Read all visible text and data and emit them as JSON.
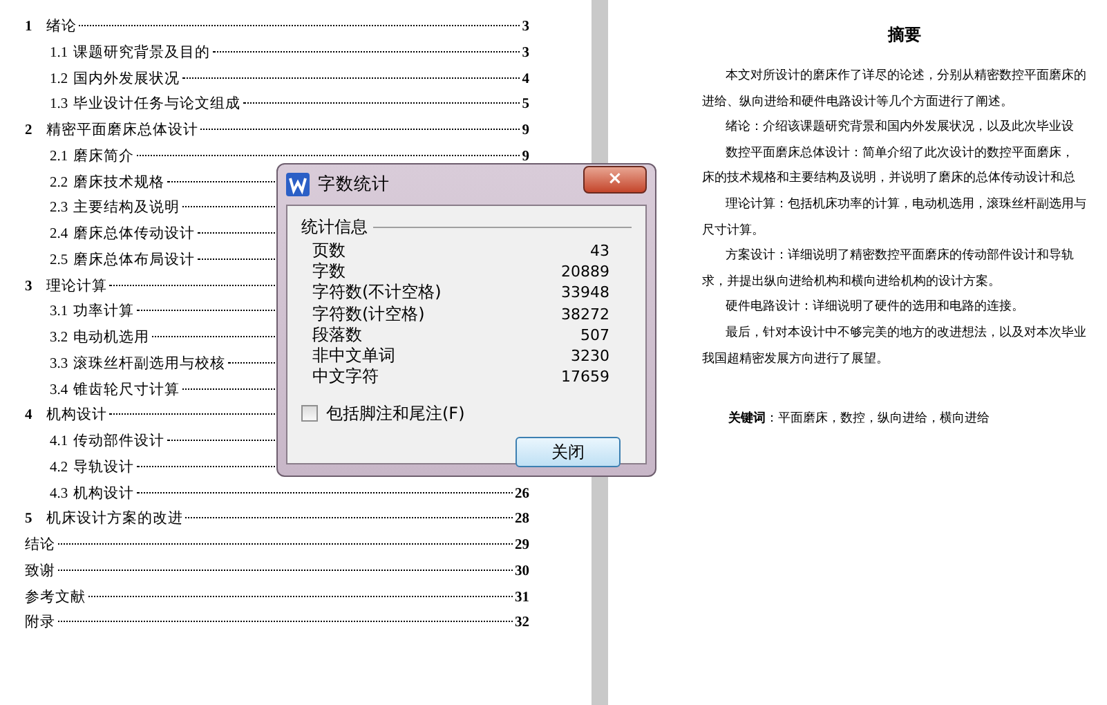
{
  "toc": [
    {
      "num": "1",
      "title": "绪论",
      "page": "3",
      "children": [
        {
          "num": "1.1",
          "title": "课题研究背景及目的",
          "page": "3"
        },
        {
          "num": "1.2",
          "title": "国内外发展状况",
          "page": "4"
        },
        {
          "num": "1.3",
          "title": "毕业设计任务与论文组成",
          "page": "5"
        }
      ]
    },
    {
      "num": "2",
      "title": "精密平面磨床总体设计",
      "page": "9",
      "children": [
        {
          "num": "2.1",
          "title": "磨床简介",
          "page": "9"
        },
        {
          "num": "2.2",
          "title": "磨床技术规格"
        },
        {
          "num": "2.3",
          "title": "主要结构及说明"
        },
        {
          "num": "2.4",
          "title": "磨床总体传动设计"
        },
        {
          "num": "2.5",
          "title": "磨床总体布局设计"
        }
      ]
    },
    {
      "num": "3",
      "title": "理论计算",
      "children": [
        {
          "num": "3.1",
          "title": "功率计算"
        },
        {
          "num": "3.2",
          "title": "电动机选用"
        },
        {
          "num": "3.3",
          "title": "滚珠丝杆副选用与校核"
        },
        {
          "num": "3.4",
          "title": "锥齿轮尺寸计算"
        }
      ]
    },
    {
      "num": "4",
      "title": "机构设计",
      "children": [
        {
          "num": "4.1",
          "title": "传动部件设计"
        },
        {
          "num": "4.2",
          "title": "导轨设计"
        },
        {
          "num": "4.3",
          "title": "机构设计",
          "page": "26"
        }
      ]
    },
    {
      "num": "5",
      "title": "机床设计方案的改进",
      "page": "28"
    },
    {
      "title": "结论",
      "page": "29"
    },
    {
      "title": "致谢",
      "page": "30"
    },
    {
      "title": "参考文献",
      "page": "31"
    },
    {
      "title": "附录",
      "page": "32"
    }
  ],
  "abstract": {
    "title": "摘要",
    "lines": [
      {
        "text": "本文对所设计的磨床作了详尽的论述，分别从精密数控平面磨床的",
        "indent": true
      },
      {
        "text": "进给、纵向进给和硬件电路设计等几个方面进行了阐述。",
        "indent": false
      },
      {
        "text": "绪论：介绍该课题研究背景和国内外发展状况，以及此次毕业设",
        "indent": true
      },
      {
        "text": "数控平面磨床总体设计：简单介绍了此次设计的数控平面磨床，",
        "indent": true
      },
      {
        "text": "床的技术规格和主要结构及说明，并说明了磨床的总体传动设计和总",
        "indent": false
      },
      {
        "text": "理论计算：包括机床功率的计算，电动机选用，滚珠丝杆副选用与",
        "indent": true
      },
      {
        "text": "尺寸计算。",
        "indent": false
      },
      {
        "text": "方案设计：详细说明了精密数控平面磨床的传动部件设计和导轨",
        "indent": true
      },
      {
        "text": "求，并提出纵向进给机构和横向进给机构的设计方案。",
        "indent": false
      },
      {
        "text": "硬件电路设计：详细说明了硬件的选用和电路的连接。",
        "indent": true
      },
      {
        "text": "最后，针对本设计中不够完美的地方的改进想法，以及对本次毕业",
        "indent": true
      },
      {
        "text": "我国超精密发展方向进行了展望。",
        "indent": false
      }
    ],
    "keywords_label": "关键词",
    "keywords": "：平面磨床，数控，纵向进给，横向进给"
  },
  "dialog": {
    "title": "字数统计",
    "close": "×",
    "group": "统计信息",
    "stats": [
      {
        "label": "页数",
        "value": "43"
      },
      {
        "label": "字数",
        "value": "20889"
      },
      {
        "label": "字符数(不计空格)",
        "value": "33948"
      },
      {
        "label": "字符数(计空格)",
        "value": "38272"
      },
      {
        "label": "段落数",
        "value": "507"
      },
      {
        "label": "非中文单词",
        "value": "3230"
      },
      {
        "label": "中文字符",
        "value": "17659"
      }
    ],
    "checkbox": {
      "label": "包括脚注和尾注(F)",
      "checked": false
    },
    "button": "关闭"
  }
}
